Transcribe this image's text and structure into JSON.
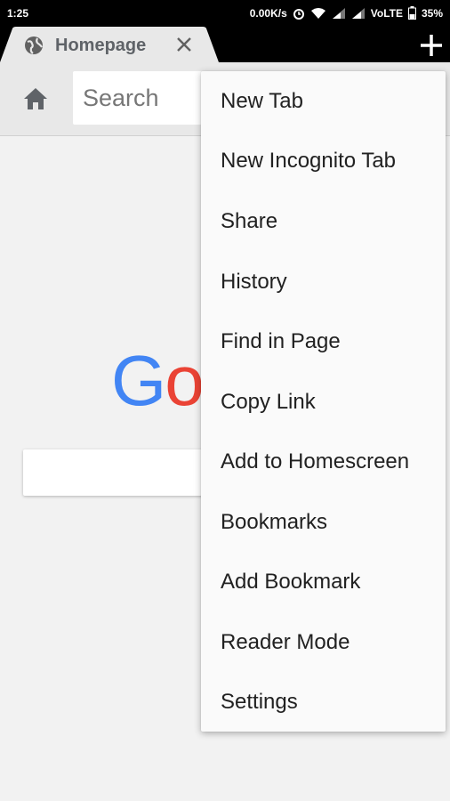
{
  "status_bar": {
    "time": "1:25",
    "net_speed": "0.00K/s",
    "network": "VoLTE",
    "battery": "35%"
  },
  "tab": {
    "title": "Homepage"
  },
  "toolbar": {
    "search_placeholder": "Search"
  },
  "page": {
    "logo_letters": [
      "G",
      "o"
    ],
    "colors": {
      "blue": "#4285F4",
      "red": "#EA4335"
    }
  },
  "menu": {
    "items": [
      {
        "label": "New Tab"
      },
      {
        "label": "New Incognito Tab"
      },
      {
        "label": "Share"
      },
      {
        "label": "History"
      },
      {
        "label": "Find in Page"
      },
      {
        "label": "Copy Link"
      },
      {
        "label": "Add to Homescreen"
      },
      {
        "label": "Bookmarks"
      },
      {
        "label": "Add Bookmark"
      },
      {
        "label": "Reader Mode"
      },
      {
        "label": "Settings"
      }
    ]
  }
}
